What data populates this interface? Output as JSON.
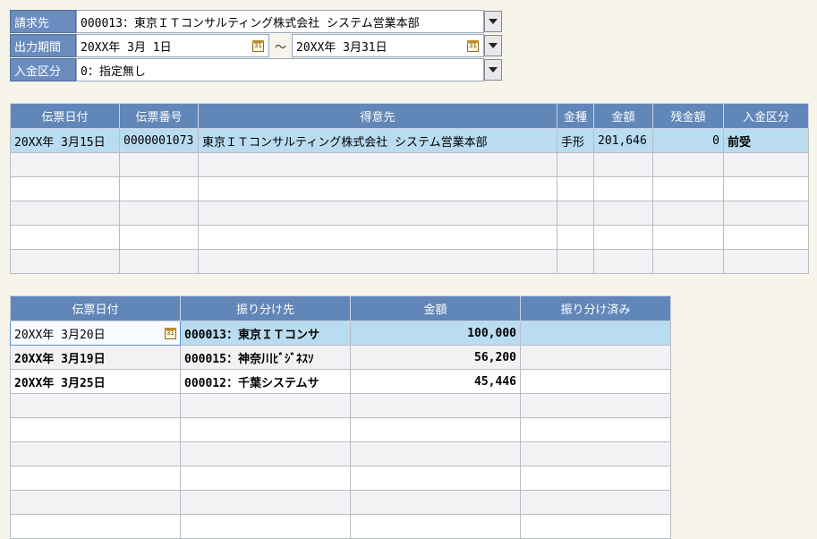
{
  "filter": {
    "billing_label": "請求先",
    "billing_value": "000013：東京ＩＴコンサルティング株式会社 システム営業本部",
    "period_label": "出力期間",
    "period_from": "20XX年 3月 1日",
    "period_sep": "～",
    "period_to": "20XX年 3月31日",
    "payment_label": "入金区分",
    "payment_value": "0：指定無し",
    "calendar_icon_text": "31"
  },
  "table1": {
    "headers": [
      "伝票日付",
      "伝票番号",
      "得意先",
      "金種",
      "金額",
      "残金額",
      "入金区分"
    ],
    "rows": [
      {
        "date": "20XX年 3月15日",
        "number": "0000001073",
        "customer": "東京ＩＴコンサルティング株式会社 システム営業本部",
        "kind": "手形",
        "amount": "201,646",
        "remaining": "0",
        "payment_type": "前受"
      }
    ]
  },
  "table2": {
    "headers": [
      "伝票日付",
      "振り分け先",
      "金額",
      "振り分け済み"
    ],
    "rows": [
      {
        "date": "20XX年 3月20日",
        "dest": "000013：東京ＩＴコンサ",
        "amount": "100,000",
        "done": ""
      },
      {
        "date": "20XX年 3月19日",
        "dest": "000015：神奈川ﾋﾞｼﾞﾈｽｿ",
        "amount": "56,200",
        "done": ""
      },
      {
        "date": "20XX年 3月25日",
        "dest": "000012：千葉システムサ",
        "amount": "45,446",
        "done": ""
      }
    ]
  }
}
